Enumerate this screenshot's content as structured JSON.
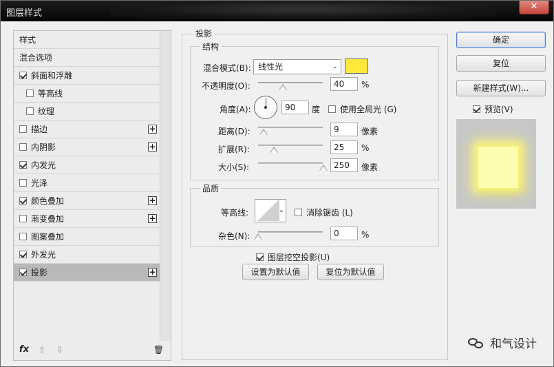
{
  "window": {
    "title": "图层样式",
    "close_label": "✕"
  },
  "left_panel": {
    "items": [
      {
        "label": "样式",
        "checkbox": false,
        "checked": false,
        "plus": false,
        "sub": false
      },
      {
        "label": "混合选项",
        "checkbox": false,
        "checked": false,
        "plus": false,
        "sub": false
      },
      {
        "label": "斜面和浮雕",
        "checkbox": true,
        "checked": true,
        "plus": false,
        "sub": false
      },
      {
        "label": "等高线",
        "checkbox": true,
        "checked": false,
        "plus": false,
        "sub": true
      },
      {
        "label": "纹理",
        "checkbox": true,
        "checked": false,
        "plus": false,
        "sub": true
      },
      {
        "label": "描边",
        "checkbox": true,
        "checked": false,
        "plus": true,
        "sub": false
      },
      {
        "label": "内阴影",
        "checkbox": true,
        "checked": false,
        "plus": true,
        "sub": false
      },
      {
        "label": "内发光",
        "checkbox": true,
        "checked": true,
        "plus": false,
        "sub": false
      },
      {
        "label": "光泽",
        "checkbox": true,
        "checked": false,
        "plus": false,
        "sub": false
      },
      {
        "label": "颜色叠加",
        "checkbox": true,
        "checked": true,
        "plus": true,
        "sub": false
      },
      {
        "label": "渐变叠加",
        "checkbox": true,
        "checked": false,
        "plus": true,
        "sub": false
      },
      {
        "label": "图案叠加",
        "checkbox": true,
        "checked": false,
        "plus": false,
        "sub": false
      },
      {
        "label": "外发光",
        "checkbox": true,
        "checked": true,
        "plus": false,
        "sub": false
      },
      {
        "label": "投影",
        "checkbox": true,
        "checked": true,
        "plus": true,
        "sub": false,
        "selected": true
      }
    ],
    "footer": {
      "fx": "fx",
      "up": "⇧",
      "down": "⇩",
      "trash": "🗑"
    }
  },
  "drop_shadow": {
    "title": "投影",
    "structure": {
      "title": "结构",
      "blend_mode_label": "混合模式(B):",
      "blend_mode_value": "线性光",
      "color": "#fee93a",
      "opacity_label": "不透明度(O):",
      "opacity_value": "40",
      "opacity_unit": "%",
      "opacity_level": 0.4,
      "angle_label": "角度(A):",
      "angle_value": "90",
      "angle_unit": "度",
      "global_light_label": "使用全局光 (G)",
      "global_light_checked": false,
      "distance_label": "距离(D):",
      "distance_value": "9",
      "distance_unit": "像素",
      "spread_label": "扩展(R):",
      "spread_value": "25",
      "spread_unit": "%",
      "size_label": "大小(S):",
      "size_value": "250",
      "size_unit": "像素"
    },
    "quality": {
      "title": "品质",
      "contour_label": "等高线:",
      "antialias_label": "消除锯齿 (L)",
      "antialias_checked": false,
      "noise_label": "杂色(N):",
      "noise_value": "0",
      "noise_unit": "%"
    },
    "knockout_label": "图层挖空投影(U)",
    "knockout_checked": true,
    "set_default_label": "设置为默认值",
    "reset_default_label": "复位为默认值"
  },
  "right_panel": {
    "ok_label": "确定",
    "reset_label": "复位",
    "new_style_label": "新建样式(W)...",
    "preview_label": "预览(V)",
    "preview_checked": true
  },
  "watermark": {
    "text": "和气设计"
  }
}
